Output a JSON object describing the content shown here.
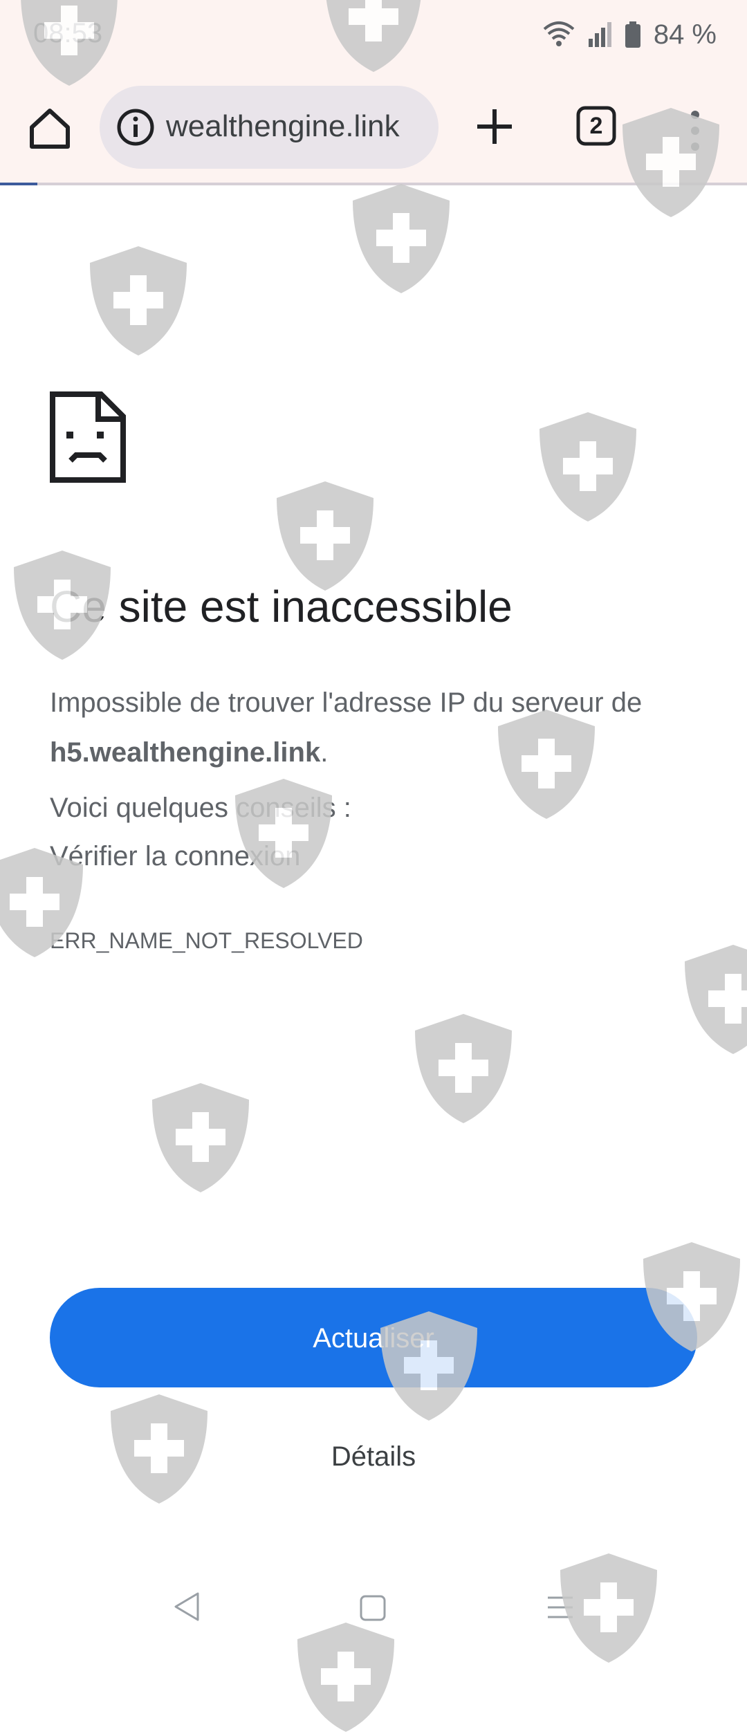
{
  "status_bar": {
    "time": "08:53",
    "battery": "84 %"
  },
  "toolbar": {
    "url": "wealthengine.link",
    "tab_count": "2",
    "load_progress": 0.05
  },
  "error_page": {
    "title": "Ce site est inaccessible",
    "description_prefix": "Impossible de trouver l'adresse IP du serveur de ",
    "host": "h5.wealthengine.link",
    "description_suffix": ".",
    "tips_heading": "Voici quelques conseils :",
    "tips": [
      "Vérifier la connexion"
    ],
    "error_code": "ERR_NAME_NOT_RESOLVED",
    "reload_label": "Actualiser",
    "details_label": "Détails"
  },
  "colors": {
    "accent": "#1a73e8",
    "chrome_background": "#fdf3f1",
    "watermark": "#c8c8c8"
  },
  "icons": {
    "home": "home-icon",
    "info": "info-icon",
    "new_tab": "plus-icon",
    "tabs": "tab-switcher-icon",
    "menu": "more-vert-icon",
    "error": "sad-document-icon",
    "watermark": "shield-cross-icon"
  }
}
